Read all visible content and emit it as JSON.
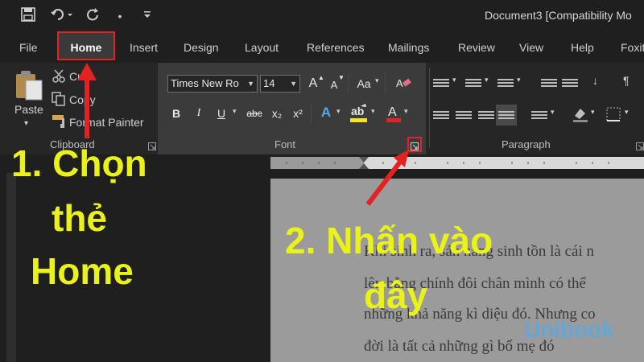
{
  "titlebar": {
    "doc_title": "Document3 [Compatibility Mo",
    "quick_access": [
      {
        "icon": "save-icon",
        "glyph": "💾"
      },
      {
        "icon": "undo-icon",
        "glyph": "↶▾"
      },
      {
        "icon": "redo-icon",
        "glyph": "↻"
      },
      {
        "icon": "dot-icon",
        "glyph": "•"
      },
      {
        "icon": "customize-icon",
        "glyph": "⩡"
      }
    ]
  },
  "tabs": {
    "file": "File",
    "home": "Home",
    "insert": "Insert",
    "design": "Design",
    "layout": "Layout",
    "references": "References",
    "mailings": "Mailings",
    "review": "Review",
    "view": "View",
    "help": "Help",
    "foxit": "Foxit"
  },
  "clipboard": {
    "paste": "Paste",
    "cut": "Cut",
    "copy": "Copy",
    "format_painter": "Format Painter",
    "group_label": "Clipboard"
  },
  "font": {
    "font_name": "Times New Ro",
    "font_size": "14",
    "group_label": "Font",
    "grow": "A",
    "shrink": "A",
    "change_case": "Aa",
    "bold": "B",
    "italic": "I",
    "underline": "U",
    "strike": "abc",
    "subscript": "x₂",
    "superscript": "x²",
    "text_effects": "A",
    "font_color": "A",
    "highlight_color": "#f5e51b",
    "font_color_bar": "#e52222"
  },
  "paragraph": {
    "group_label": "Paragraph",
    "pilcrow": "¶"
  },
  "document": {
    "lines": [
      "Khi sinh ra, sản năng sinh tồn là cái n",
      "lên bằng chính đôi chân mình có thể ",
      "những khả năng kì diệu đó. Nhưng co",
      "đời là tất cả những gì bố mẹ đó"
    ]
  },
  "annotations": {
    "step1_lines": [
      "1. Chọn",
      "thẻ",
      "Home"
    ],
    "step2_lines": [
      "2. Nhấn vào",
      "đây"
    ],
    "accent_red": "#e52222",
    "text_yellow": "#eaf21a"
  },
  "watermark": "Unibook"
}
